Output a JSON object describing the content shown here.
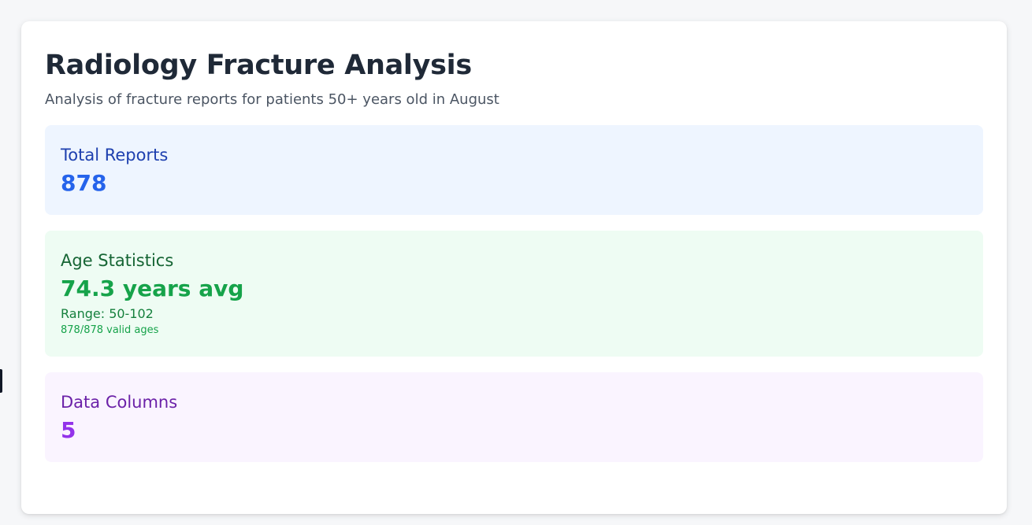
{
  "header": {
    "title": "Radiology Fracture Analysis",
    "subtitle": "Analysis of fracture reports for patients 50+ years old in August"
  },
  "stats": {
    "total_reports": {
      "label": "Total Reports",
      "value": "878"
    },
    "age_statistics": {
      "label": "Age Statistics",
      "value": "74.3 years avg",
      "range": "Range: 50-102",
      "valid": "878/878 valid ages"
    },
    "data_columns": {
      "label": "Data Columns",
      "value": "5"
    }
  },
  "colors": {
    "blue_bg": "#eef5ff",
    "blue_accent": "#2563eb",
    "green_bg": "#eefcf3",
    "green_accent": "#16a34a",
    "purple_bg": "#faf4ff",
    "purple_accent": "#9333ea"
  }
}
